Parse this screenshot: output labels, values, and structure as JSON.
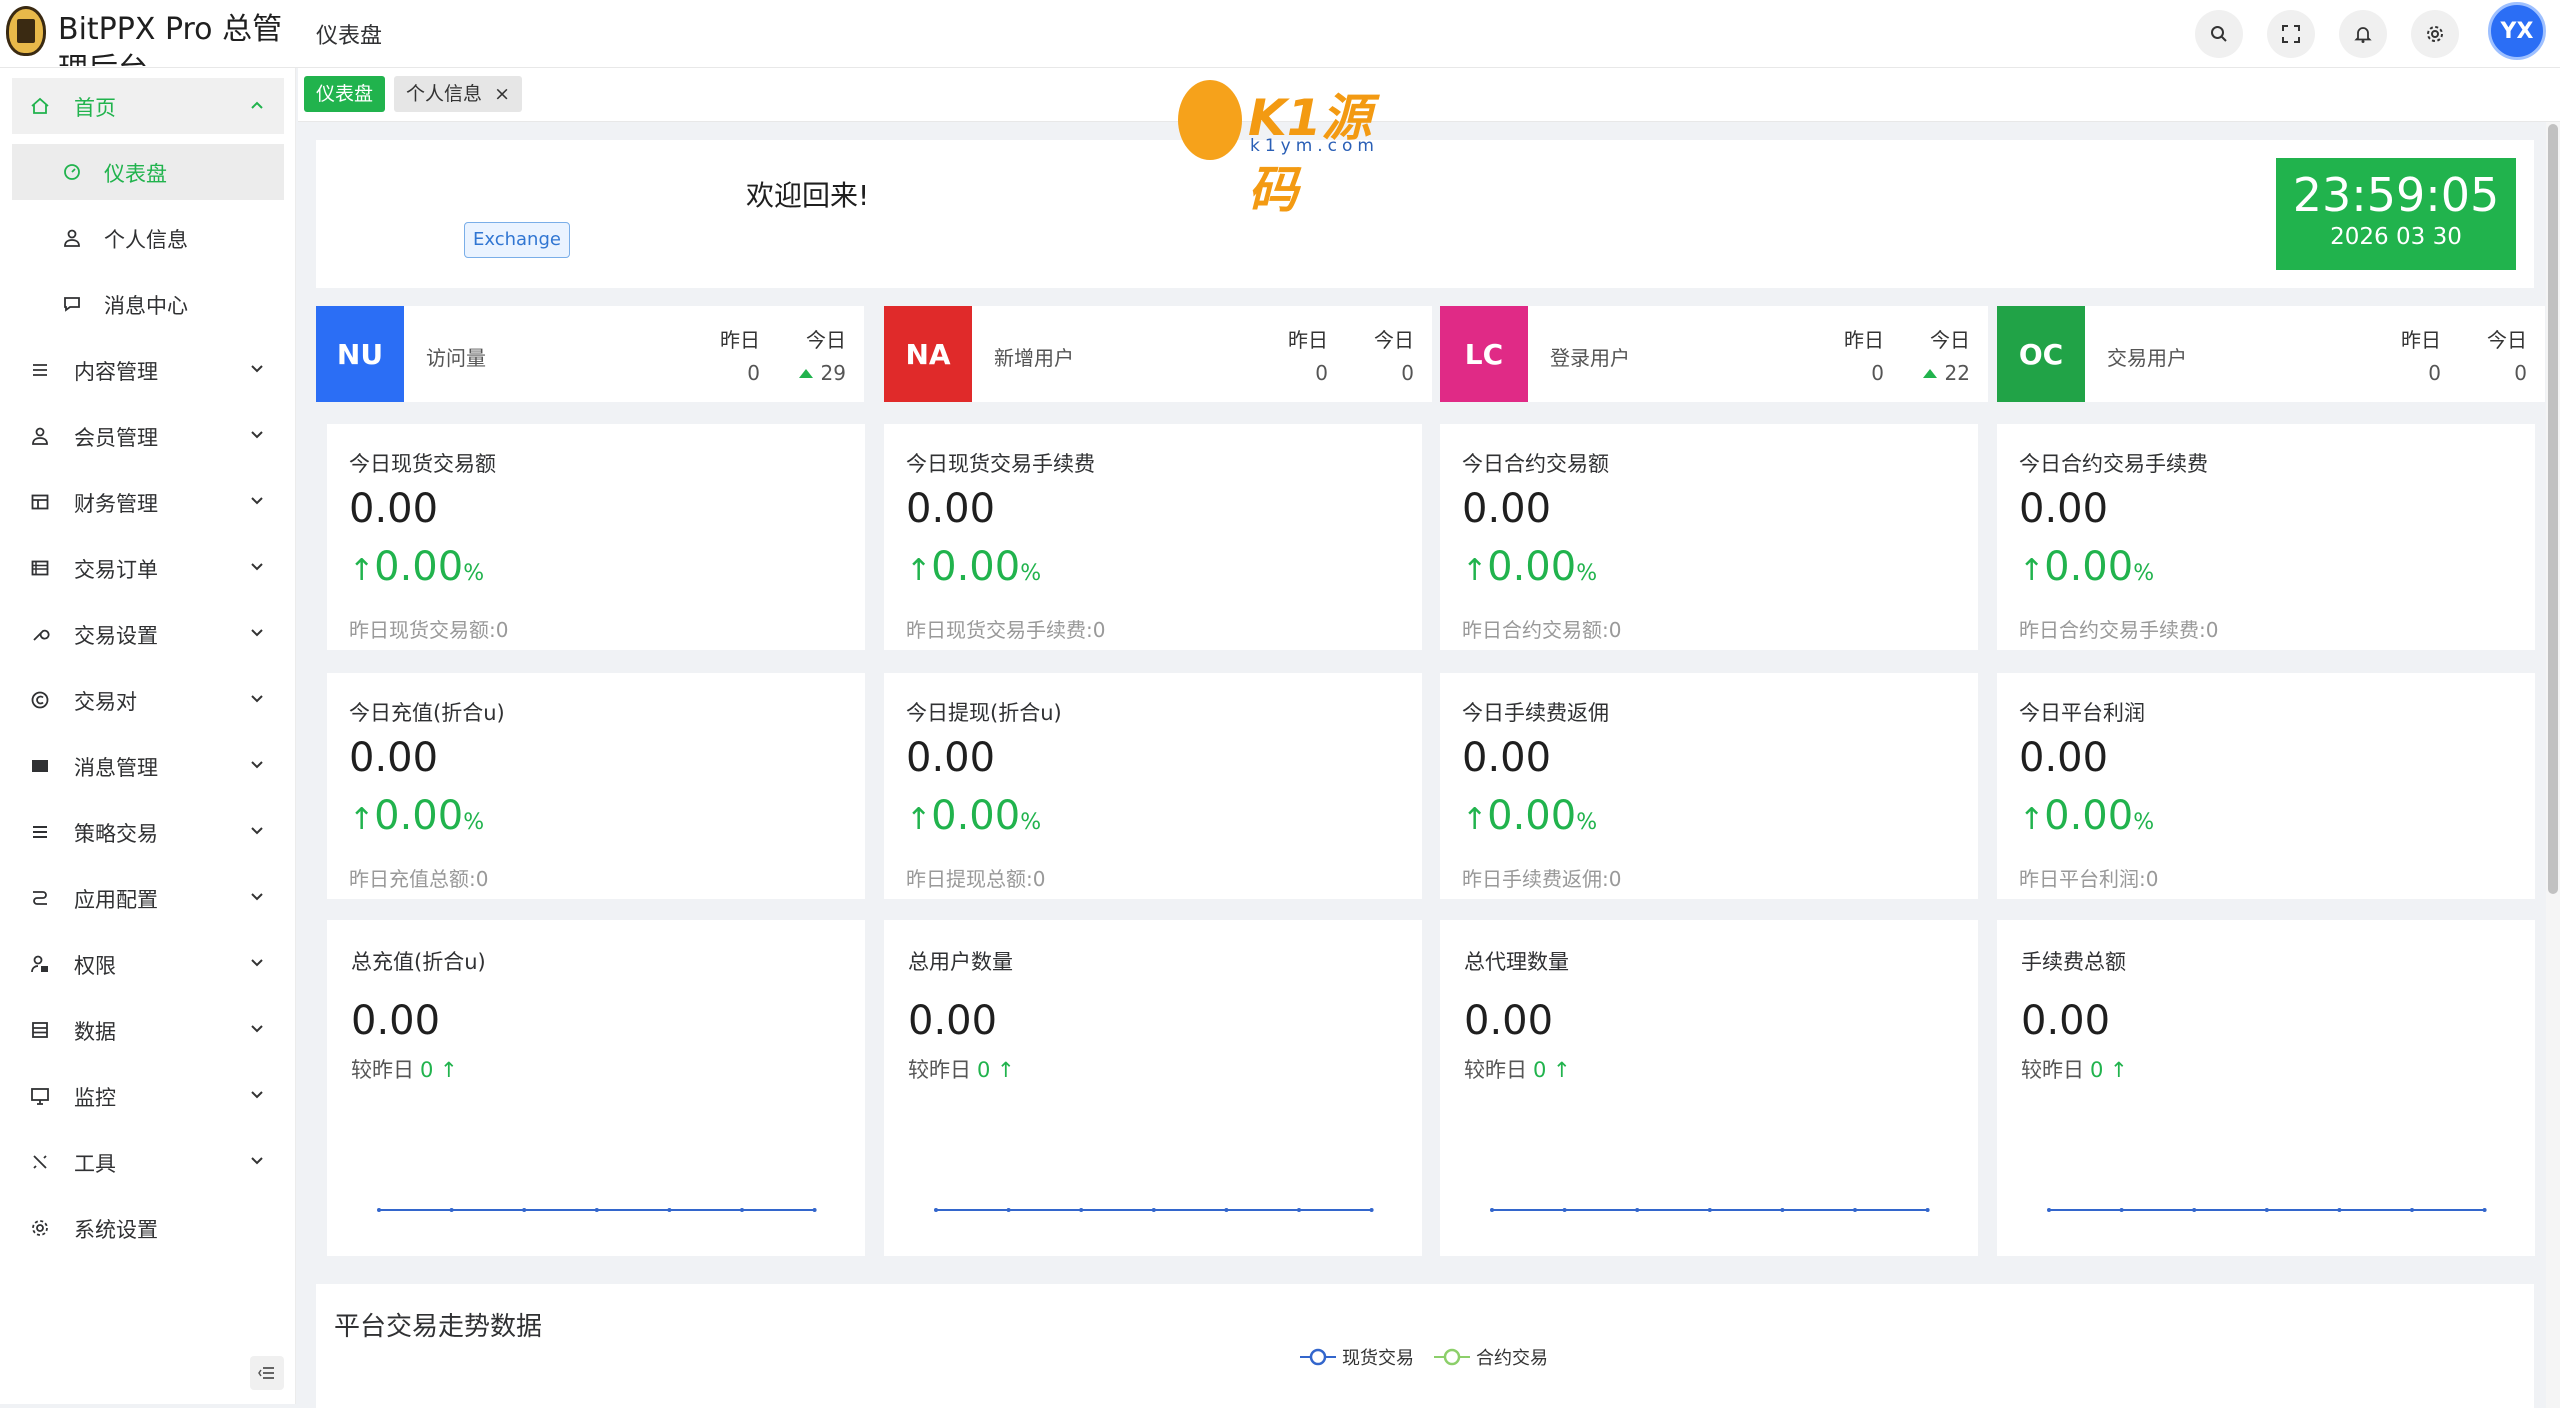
{
  "header": {
    "app_title": "BitPPX Pro 总管理后台",
    "page_title": "仪表盘",
    "buttons": [
      "search-icon",
      "fullscreen-icon",
      "bell-icon",
      "gear-icon"
    ],
    "avatar_text": "YX"
  },
  "sidebar": {
    "items": [
      {
        "label": "首页",
        "icon": "home-icon",
        "expanded": true
      },
      {
        "label": "仪表盘",
        "icon": "dashboard-icon",
        "sub": true,
        "active": true
      },
      {
        "label": "个人信息",
        "icon": "user-icon",
        "sub": true
      },
      {
        "label": "消息中心",
        "icon": "message-icon",
        "sub": true
      },
      {
        "label": "内容管理",
        "icon": "list-icon"
      },
      {
        "label": "会员管理",
        "icon": "user-icon"
      },
      {
        "label": "财务管理",
        "icon": "table-icon"
      },
      {
        "label": "交易订单",
        "icon": "orders-icon"
      },
      {
        "label": "交易设置",
        "icon": "wrench-icon"
      },
      {
        "label": "交易对",
        "icon": "copyright-icon"
      },
      {
        "label": "消息管理",
        "icon": "mail-icon"
      },
      {
        "label": "策略交易",
        "icon": "menu-icon"
      },
      {
        "label": "应用配置",
        "icon": "app-icon"
      },
      {
        "label": "权限",
        "icon": "user-lock-icon"
      },
      {
        "label": "数据",
        "icon": "database-icon"
      },
      {
        "label": "监控",
        "icon": "monitor-icon"
      },
      {
        "label": "工具",
        "icon": "tool-icon"
      },
      {
        "label": "系统设置",
        "icon": "gear-icon"
      }
    ]
  },
  "tabs": [
    {
      "label": "仪表盘",
      "active": true
    },
    {
      "label": "个人信息",
      "close": "×"
    }
  ],
  "welcome": {
    "text": "欢迎回来!",
    "exchange_button": "Exchange",
    "clock_time": "23:59:05",
    "clock_date": "2026 03 30"
  },
  "watermark": {
    "main": "K1源码",
    "sub": "k1ym.com"
  },
  "stats": [
    {
      "badge": "NU",
      "color": "#2b6ef5",
      "name": "访问量",
      "yesterday_label": "昨日",
      "yesterday": "0",
      "today_label": "今日",
      "today": "29",
      "up": true
    },
    {
      "badge": "NA",
      "color": "#e02a2a",
      "name": "新增用户",
      "yesterday_label": "昨日",
      "yesterday": "0",
      "today_label": "今日",
      "today": "0",
      "up": false
    },
    {
      "badge": "LC",
      "color": "#e02a86",
      "name": "登录用户",
      "yesterday_label": "昨日",
      "yesterday": "0",
      "today_label": "今日",
      "today": "22",
      "up": true
    },
    {
      "badge": "OC",
      "color": "#21a347",
      "name": "交易用户",
      "yesterday_label": "昨日",
      "yesterday": "0",
      "today_label": "今日",
      "today": "0",
      "up": false
    }
  ],
  "cards": [
    {
      "title": "今日现货交易额",
      "value": "0.00",
      "pct": "0.00",
      "pct_unit": "%",
      "yesterday": "昨日现货交易额:0"
    },
    {
      "title": "今日现货交易手续费",
      "value": "0.00",
      "pct": "0.00",
      "pct_unit": "%",
      "yesterday": "昨日现货交易手续费:0"
    },
    {
      "title": "今日合约交易额",
      "value": "0.00",
      "pct": "0.00",
      "pct_unit": "%",
      "yesterday": "昨日合约交易额:0"
    },
    {
      "title": "今日合约交易手续费",
      "value": "0.00",
      "pct": "0.00",
      "pct_unit": "%",
      "yesterday": "昨日合约交易手续费:0"
    },
    {
      "title": "今日充值(折合u)",
      "value": "0.00",
      "pct": "0.00",
      "pct_unit": "%",
      "yesterday": "昨日充值总额:0"
    },
    {
      "title": "今日提现(折合u)",
      "value": "0.00",
      "pct": "0.00",
      "pct_unit": "%",
      "yesterday": "昨日提现总额:0"
    },
    {
      "title": "今日手续费返佣",
      "value": "0.00",
      "pct": "0.00",
      "pct_unit": "%",
      "yesterday": "昨日手续费返佣:0"
    },
    {
      "title": "今日平台利润",
      "value": "0.00",
      "pct": "0.00",
      "pct_unit": "%",
      "yesterday": "昨日平台利润:0"
    }
  ],
  "totals": [
    {
      "title": "总充值(折合u)",
      "value": "0.00",
      "compare_label": "较昨日",
      "compare": "0"
    },
    {
      "title": "总用户数量",
      "value": "0.00",
      "compare_label": "较昨日",
      "compare": "0"
    },
    {
      "title": "总代理数量",
      "value": "0.00",
      "compare_label": "较昨日",
      "compare": "0"
    },
    {
      "title": "手续费总额",
      "value": "0.00",
      "compare_label": "较昨日",
      "compare": "0"
    }
  ],
  "trend": {
    "title": "平台交易走势数据",
    "legend": [
      {
        "label": "现货交易",
        "color": "#3366cc"
      },
      {
        "label": "合约交易",
        "color": "#8ccf6a"
      }
    ]
  },
  "colors": {
    "accent": "#21b34d",
    "up": "#21b34d",
    "link": "#3176d2"
  }
}
